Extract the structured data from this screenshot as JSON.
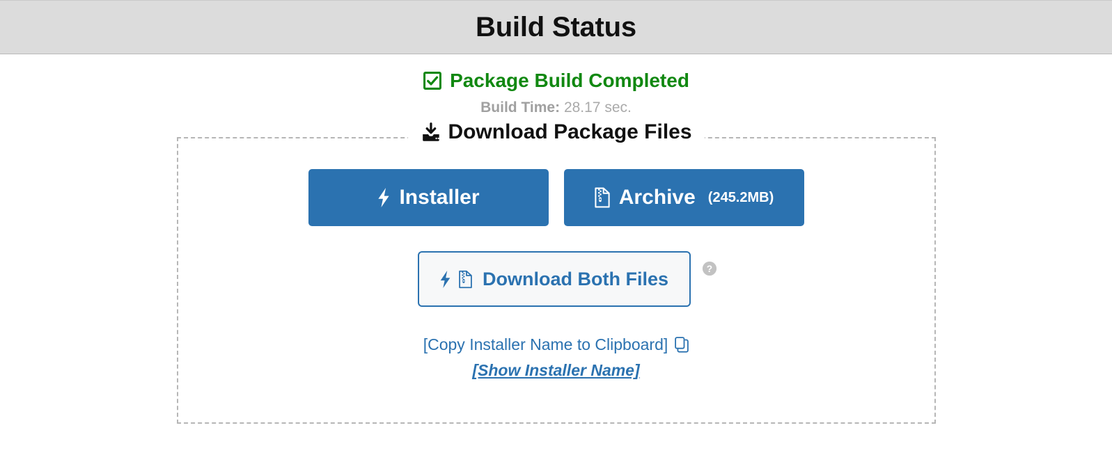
{
  "header": {
    "title": "Build Status",
    "background": "#dcdcdc"
  },
  "status": {
    "icon": "check-square-icon",
    "message": "Package Build Completed",
    "color": "#118811",
    "build_time_label": "Build Time:",
    "build_time_value": "28.17 sec."
  },
  "panel": {
    "legend_icon": "download-icon",
    "legend": "Download Package Files",
    "border_color": "#b6b6b6"
  },
  "buttons": {
    "installer": {
      "icon": "bolt-icon",
      "label": "Installer",
      "color": "#2b72b0"
    },
    "archive": {
      "icon": "file-archive-icon",
      "label": "Archive",
      "size": "(245.2MB)",
      "color": "#2b72b0"
    },
    "both": {
      "icon_bolt": "bolt-icon",
      "icon_archive": "file-archive-icon",
      "label": "Download Both Files",
      "color": "#2b72b0",
      "help_icon": "question-circle-icon"
    }
  },
  "links": {
    "copy_installer_name": "[Copy Installer Name to Clipboard]",
    "copy_icon": "copy-icon",
    "show_installer_name": "[Show Installer Name]",
    "color": "#2b72b0"
  }
}
